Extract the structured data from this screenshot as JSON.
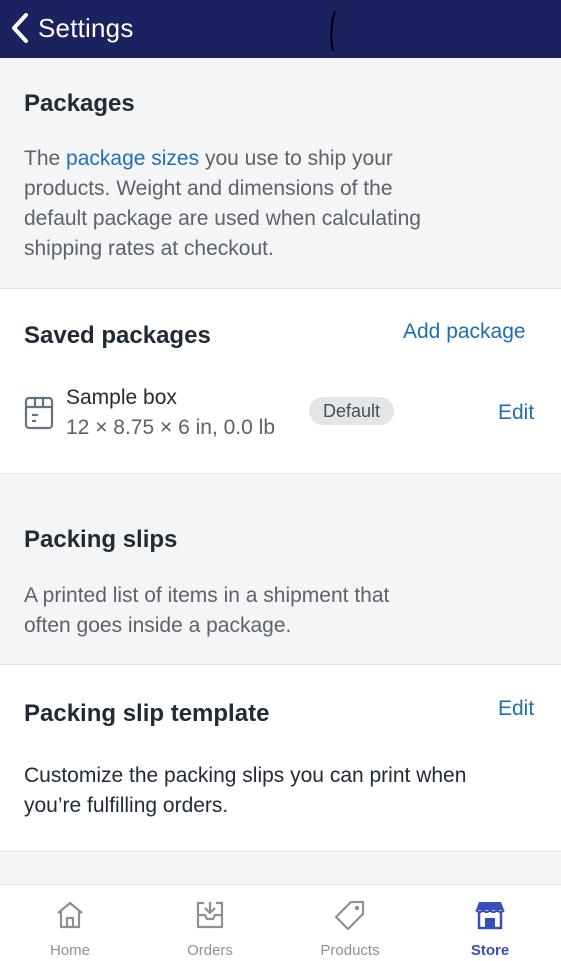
{
  "header": {
    "back_label": "Settings"
  },
  "packages": {
    "title": "Packages",
    "desc_prefix": "The ",
    "desc_link": "package sizes",
    "desc_line1_suffix": " you use to ship your",
    "desc_line2": "products. Weight and dimensions of the",
    "desc_line3": "default package are used when calculating",
    "desc_line4": "shipping rates at checkout."
  },
  "saved_packages": {
    "title": "Saved packages",
    "add_label": "Add package",
    "items": [
      {
        "name": "Sample box",
        "dimensions": "12 × 8.75 × 6 in, 0.0 lb",
        "badge": "Default",
        "edit_label": "Edit",
        "icon": "box-icon"
      }
    ]
  },
  "packing_slips": {
    "title": "Packing slips",
    "desc_line1": "A printed list of items in a shipment that",
    "desc_line2": "often goes inside a package."
  },
  "packing_slip_template": {
    "title": "Packing slip template",
    "edit_label": "Edit",
    "desc_line1": "Customize the packing slips you can print when",
    "desc_line2": "you’re fulfilling orders."
  },
  "tabs": [
    {
      "label": "Home",
      "icon": "home-icon",
      "active": false
    },
    {
      "label": "Orders",
      "icon": "orders-icon",
      "active": false
    },
    {
      "label": "Products",
      "icon": "tag-icon",
      "active": false
    },
    {
      "label": "Store",
      "icon": "store-icon",
      "active": true
    }
  ],
  "colors": {
    "header_bg": "#1c2260",
    "link": "#1f6fb5",
    "active_tab": "#3b4eb8"
  }
}
